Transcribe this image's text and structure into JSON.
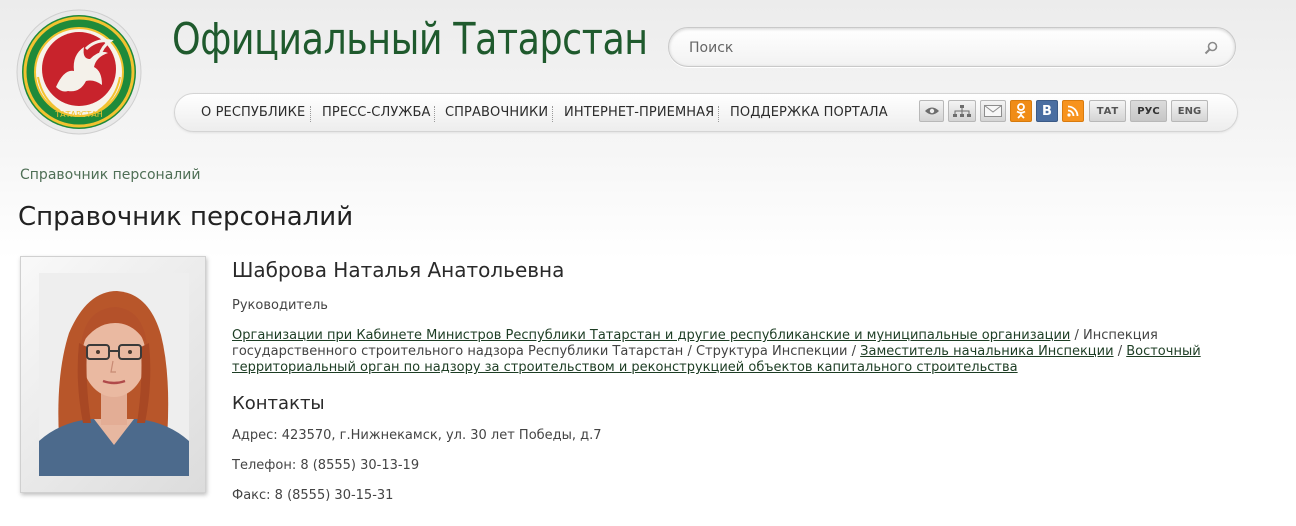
{
  "site": {
    "title": "Официальный Татарстан",
    "emblem_text": "ТАТАРСТАН"
  },
  "search": {
    "placeholder": "Поиск"
  },
  "nav": {
    "items": [
      {
        "label": "О РЕСПУБЛИКЕ"
      },
      {
        "label": "ПРЕСС-СЛУЖБА"
      },
      {
        "label": "СПРАВОЧНИКИ"
      },
      {
        "label": "ИНТЕРНЕТ-ПРИЕМНАЯ"
      },
      {
        "label": "ПОДДЕРЖКА ПОРТАЛА"
      }
    ]
  },
  "toolbar": {
    "icons": [
      "eye-icon",
      "sitemap-icon",
      "mail-icon",
      "odnoklassniki-icon",
      "vkontakte-icon",
      "rss-icon"
    ],
    "vk_label": "В",
    "languages": [
      {
        "label": "ТАТ"
      },
      {
        "label": "РУС"
      },
      {
        "label": "ENG"
      }
    ]
  },
  "breadcrumb": "Справочник персоналий",
  "page_title": "Справочник персоналий",
  "person": {
    "name": "Шаброва Наталья Анатольевна",
    "position": "Руководитель",
    "org_path": [
      {
        "text": "Организации при Кабинете Министров Республики Татарстан и другие республиканские и муниципальные организации",
        "link": true
      },
      {
        "text": "Инспекция государственного строительного надзора Республики Татарстан",
        "link": false
      },
      {
        "text": "Структура Инспекции",
        "link": false
      },
      {
        "text": "Заместитель начальника Инспекции",
        "link": true
      },
      {
        "text": "Восточный территориальный орган по надзору за строительством и реконструкцией объектов капитального строительства",
        "link": true
      }
    ],
    "contacts_heading": "Контакты",
    "address": "Адрес: 423570, г.Нижнекамск, ул. 30 лет Победы, д.7",
    "phone": "Телефон: 8 (8555) 30-13-19",
    "fax": "Факс: 8 (8555) 30-15-31"
  },
  "colors": {
    "brand_green": "#1f5a2d",
    "emblem_red": "#c8232c",
    "ok_orange": "#f08c16",
    "vk_blue": "#4a6ea1",
    "rss_orange": "#f7931e"
  }
}
